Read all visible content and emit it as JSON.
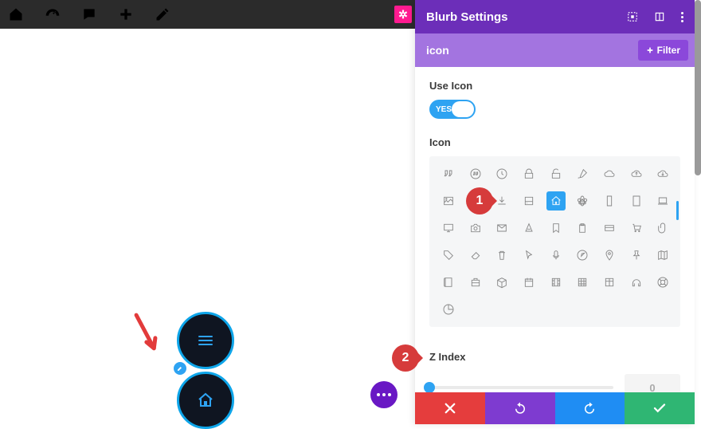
{
  "topbar": {
    "icons": [
      "home-icon",
      "gauge-icon",
      "chat-icon",
      "plus-icon",
      "pencil-icon"
    ],
    "badge_symbol": "✲"
  },
  "panel": {
    "title": "Blurb Settings",
    "search_value": "icon",
    "filter_label": "Filter"
  },
  "fields": {
    "use_icon_label": "Use Icon",
    "use_icon_value": "YES",
    "icon_label": "Icon",
    "zindex_label": "Z Index",
    "zindex_value": "0"
  },
  "icon_grid": {
    "selected_index": 13,
    "icons": [
      "quotes",
      "quotes-circle",
      "clock",
      "lock",
      "lock-open",
      "brush",
      "cloud",
      "cloud-up",
      "cloud-down",
      "image",
      "hdd",
      "download",
      "drive",
      "home",
      "atom",
      "phone",
      "tablet",
      "laptop",
      "desktop",
      "camera",
      "mail",
      "cone",
      "bookmark",
      "clipboard",
      "card",
      "cart",
      "paperclip",
      "tag",
      "eraser",
      "trash",
      "cursor",
      "mic",
      "compass",
      "pin",
      "pushpin",
      "map",
      "book",
      "briefcase",
      "box",
      "calendar",
      "film",
      "grid",
      "columns",
      "headphones",
      "lifebuoy",
      "pie"
    ]
  },
  "footer": {
    "buttons": [
      "cancel",
      "undo",
      "redo",
      "save"
    ]
  },
  "callouts": {
    "one": "1",
    "two": "2"
  }
}
